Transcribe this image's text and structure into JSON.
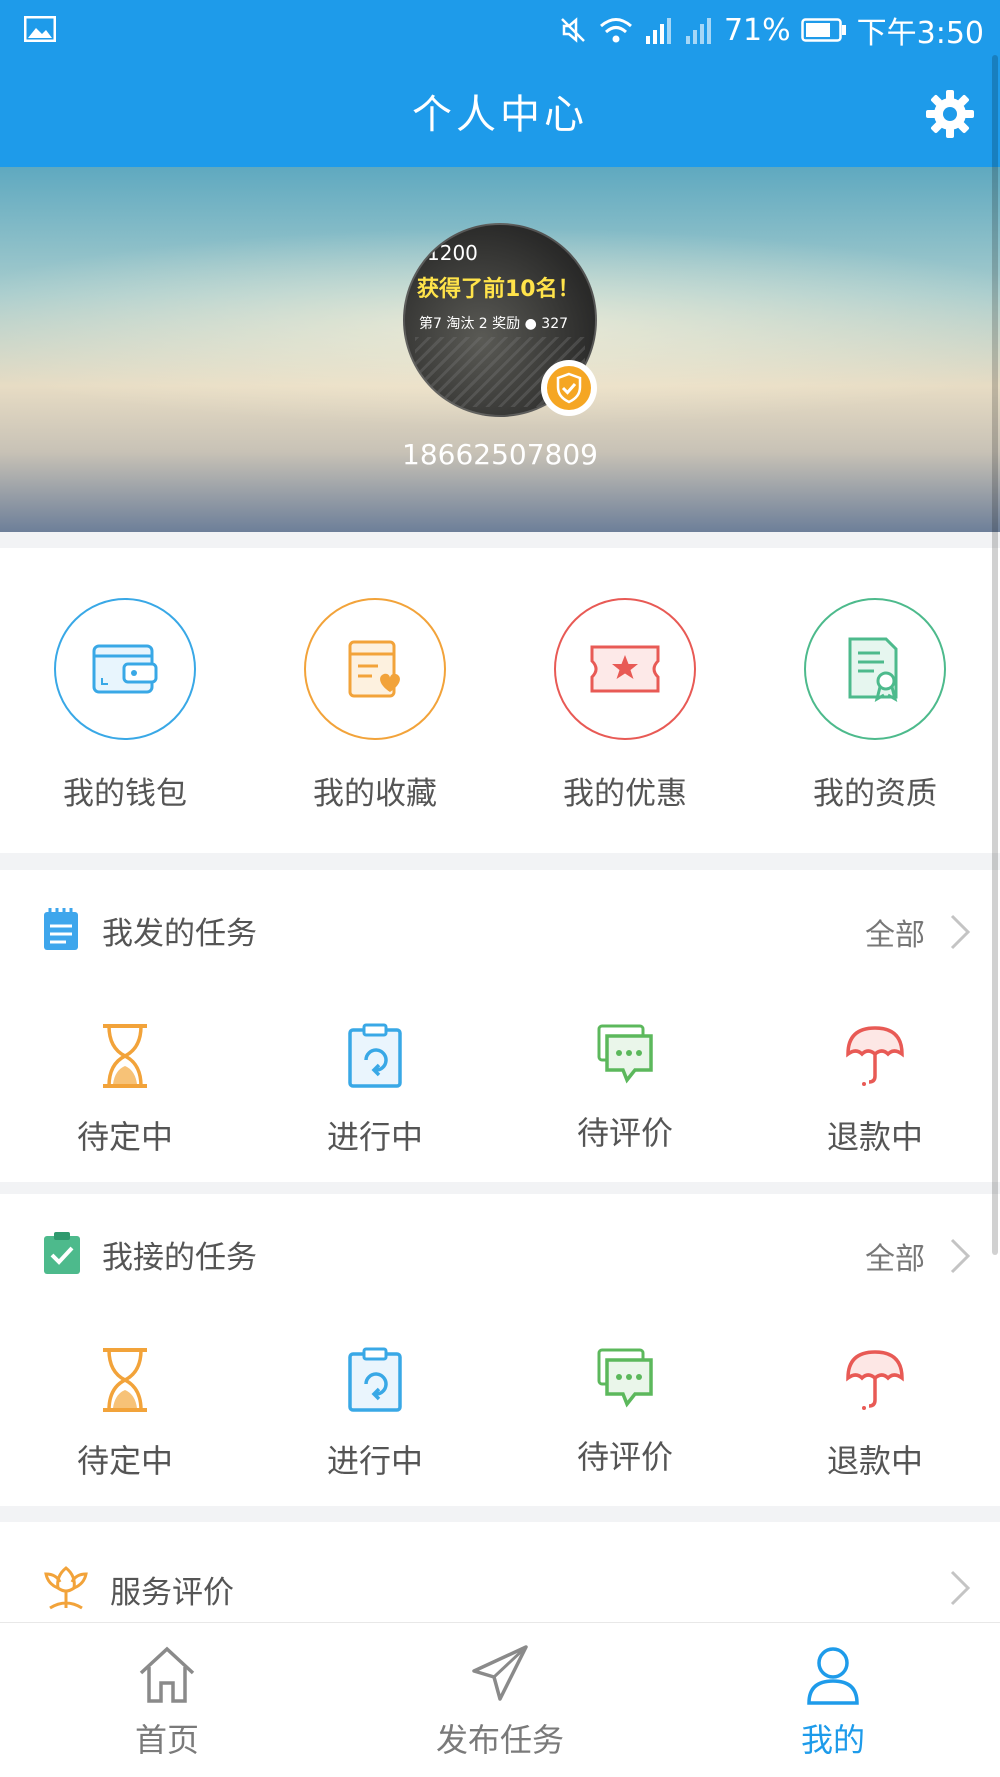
{
  "status_bar": {
    "battery": "71%",
    "time": "下午3:50"
  },
  "header": {
    "title": "个人中心"
  },
  "profile": {
    "phone": "18662507809",
    "avatar_text": {
      "line1": "1200",
      "line2": "获得了前10名！",
      "line3": "第7   淘汰 2   奖励 ● 327"
    }
  },
  "quick_links": [
    {
      "label": "我的钱包",
      "icon": "wallet-icon",
      "color": "#39a8e6"
    },
    {
      "label": "我的收藏",
      "icon": "favorites-icon",
      "color": "#f2a33a"
    },
    {
      "label": "我的优惠",
      "icon": "coupon-icon",
      "color": "#e85a55"
    },
    {
      "label": "我的资质",
      "icon": "certificate-icon",
      "color": "#4dba8c"
    }
  ],
  "published_tasks": {
    "title": "我发的任务",
    "all_label": "全部",
    "statuses": [
      {
        "label": "待定中",
        "icon": "hourglass-icon"
      },
      {
        "label": "进行中",
        "icon": "clipboard-refresh-icon"
      },
      {
        "label": "待评价",
        "icon": "chat-icon"
      },
      {
        "label": "退款中",
        "icon": "umbrella-icon"
      }
    ]
  },
  "accepted_tasks": {
    "title": "我接的任务",
    "all_label": "全部",
    "statuses": [
      {
        "label": "待定中",
        "icon": "hourglass-icon"
      },
      {
        "label": "进行中",
        "icon": "clipboard-refresh-icon"
      },
      {
        "label": "待评价",
        "icon": "chat-icon"
      },
      {
        "label": "退款中",
        "icon": "umbrella-icon"
      }
    ]
  },
  "service_review": {
    "title": "服务评价"
  },
  "tabbar": [
    {
      "label": "首页",
      "icon": "home-icon",
      "active": false
    },
    {
      "label": "发布任务",
      "icon": "paper-plane-icon",
      "active": false
    },
    {
      "label": "我的",
      "icon": "user-icon",
      "active": true
    }
  ],
  "colors": {
    "primary": "#1e9bea",
    "orange": "#f2a33a",
    "red": "#e85a55",
    "green": "#4dba8c"
  }
}
